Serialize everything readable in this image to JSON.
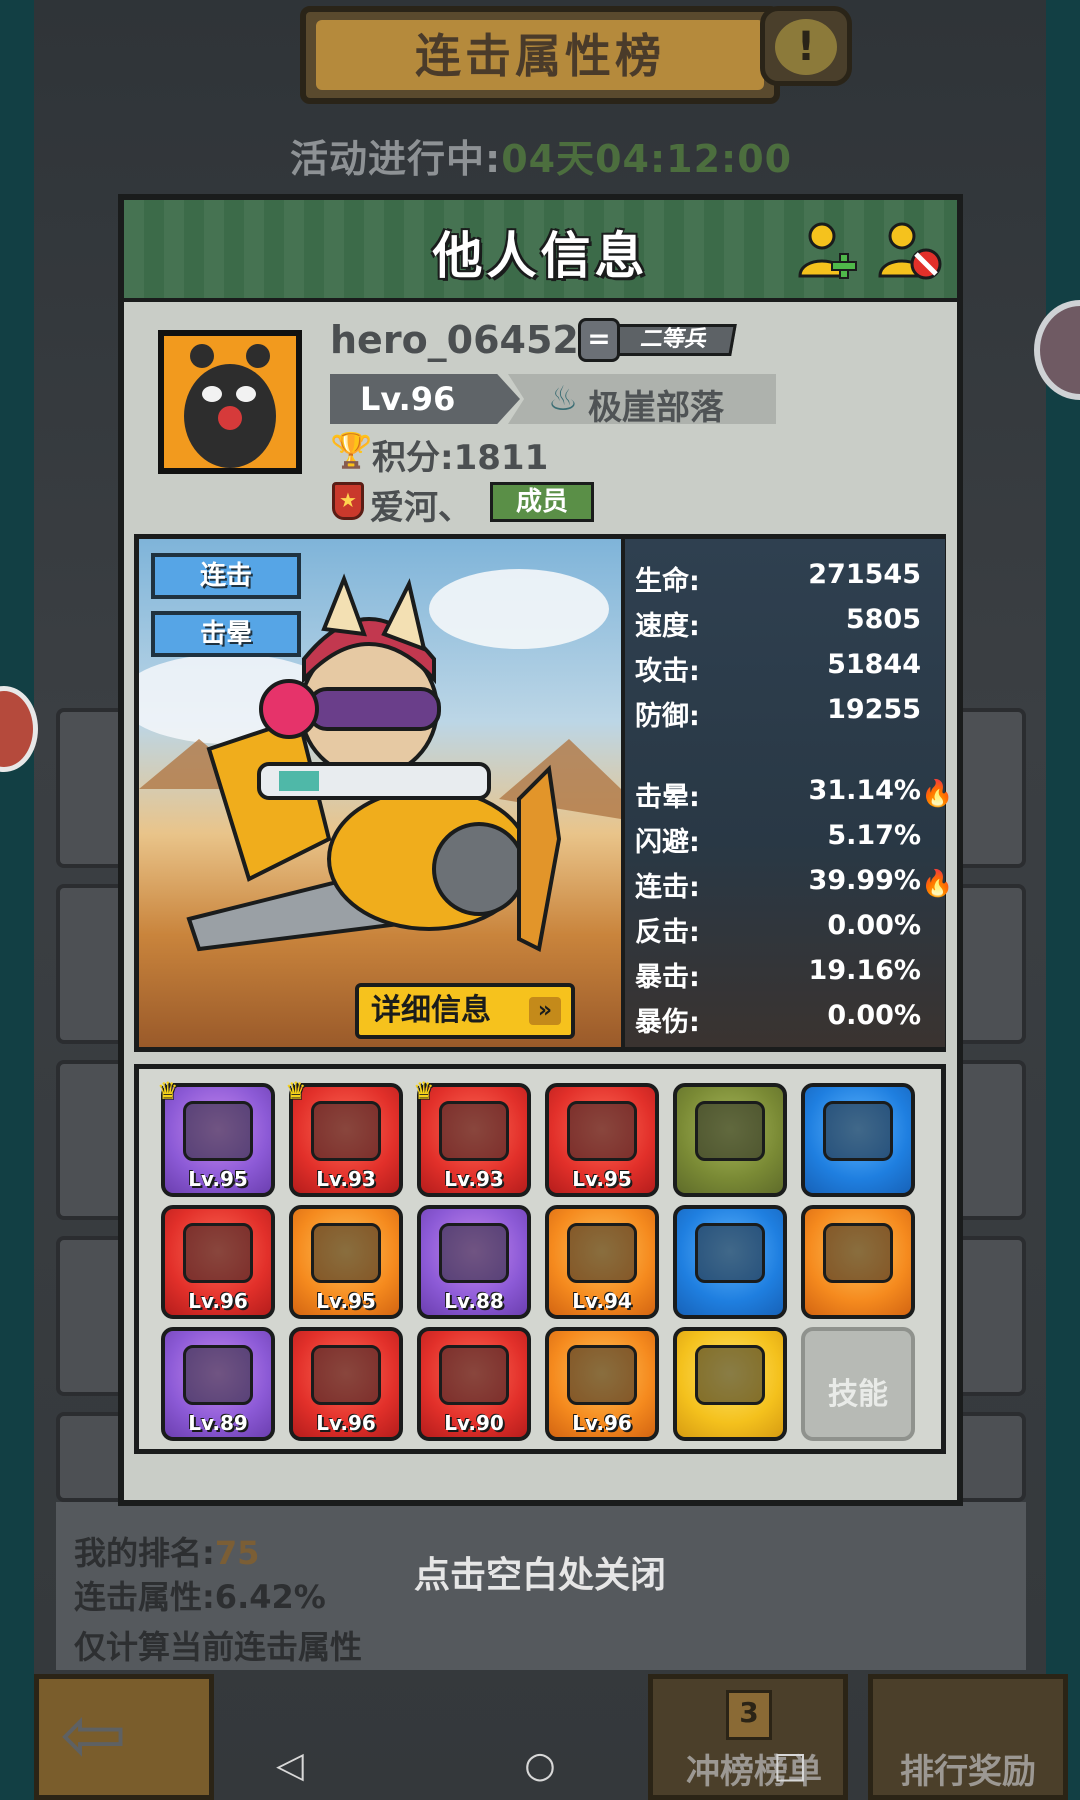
{
  "background": {
    "title": "连击属性榜",
    "event_label": "活动进行中:",
    "event_timer": "04天04:12:00",
    "alert_glyph": "!",
    "my_rank_label": "我的排名:",
    "my_rank_value": "75",
    "combo_attr": "连击属性:6.42%",
    "note": "仅计算当前连击属性",
    "close_hint": "点击空白处关闭",
    "tabs": [
      {
        "label": "冲榜榜单",
        "badge": "3"
      },
      {
        "label": "排行奖励"
      }
    ]
  },
  "modal": {
    "title": "他人信息",
    "profile": {
      "username": "hero_064520",
      "rank_symbol": "=",
      "rank_title": "二等兵",
      "level": "Lv.96",
      "tribe": "极崖部落",
      "score": "积分:1811",
      "guild": "爱河、",
      "guild_role": "成员"
    },
    "hero": {
      "tags": [
        "连击",
        "击晕"
      ],
      "detail_button": "详细信息",
      "stats_basic": [
        {
          "label": "生命:",
          "value": "271545"
        },
        {
          "label": "速度:",
          "value": "5805"
        },
        {
          "label": "攻击:",
          "value": "51844"
        },
        {
          "label": "防御:",
          "value": "19255"
        }
      ],
      "stats_special": [
        {
          "label": "击晕:",
          "value": "31.14%",
          "fire": true
        },
        {
          "label": "闪避:",
          "value": "5.17%",
          "fire": false
        },
        {
          "label": "连击:",
          "value": "39.99%",
          "fire": true
        },
        {
          "label": "反击:",
          "value": "0.00%",
          "fire": false
        },
        {
          "label": "暴击:",
          "value": "19.16%",
          "fire": false
        },
        {
          "label": "暴伤:",
          "value": "0.00%",
          "fire": false
        }
      ]
    },
    "equipment": [
      {
        "lv": "Lv.95",
        "color": "purple",
        "crown": true
      },
      {
        "lv": "Lv.93",
        "color": "red",
        "crown": true
      },
      {
        "lv": "Lv.93",
        "color": "red",
        "crown": true
      },
      {
        "lv": "Lv.95",
        "color": "red",
        "crown": false
      },
      {
        "lv": "",
        "color": "green",
        "crown": false
      },
      {
        "lv": "",
        "color": "blue",
        "crown": false
      },
      {
        "lv": "Lv.96",
        "color": "red",
        "crown": false
      },
      {
        "lv": "Lv.95",
        "color": "orange",
        "crown": false
      },
      {
        "lv": "Lv.88",
        "color": "purple",
        "crown": false
      },
      {
        "lv": "Lv.94",
        "color": "orange",
        "crown": false
      },
      {
        "lv": "",
        "color": "blue",
        "crown": false
      },
      {
        "lv": "",
        "color": "orange",
        "crown": false
      },
      {
        "lv": "Lv.89",
        "color": "purple",
        "crown": false
      },
      {
        "lv": "Lv.96",
        "color": "red",
        "crown": false
      },
      {
        "lv": "Lv.90",
        "color": "red",
        "crown": false
      },
      {
        "lv": "Lv.96",
        "color": "orange",
        "crown": false
      },
      {
        "lv": "",
        "color": "yellow",
        "crown": false
      },
      {
        "lv": "技能",
        "color": "grey",
        "crown": false
      }
    ]
  },
  "icons": {
    "add_friend": "add-friend-icon",
    "block_user": "block-user-icon",
    "trophy": "trophy-icon",
    "fire": "fire-icon",
    "back": "back-arrow-icon"
  }
}
